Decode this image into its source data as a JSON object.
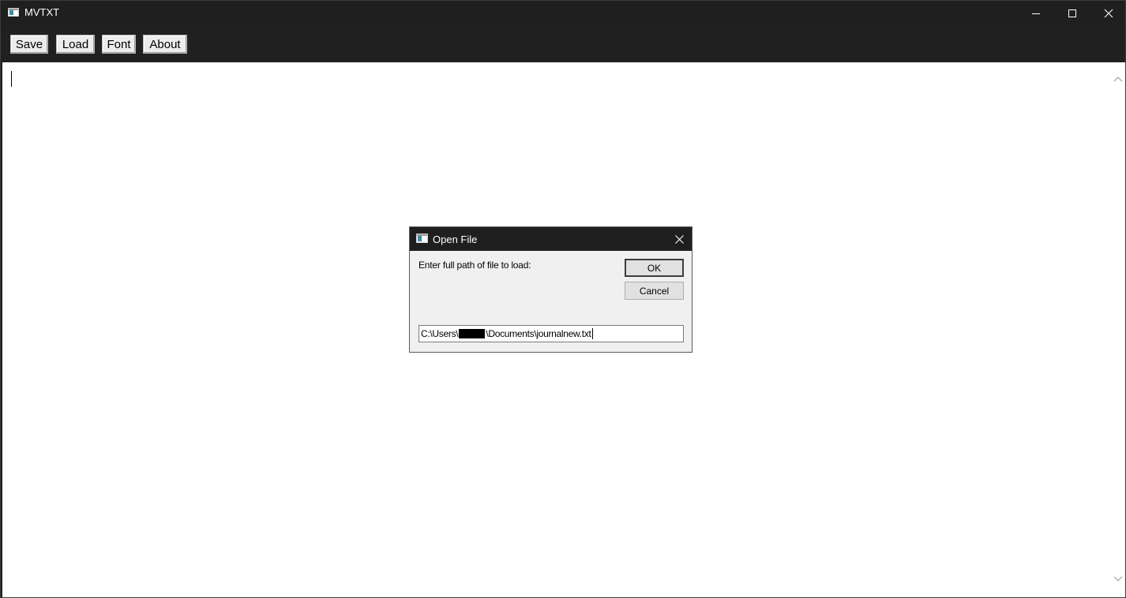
{
  "window": {
    "title": "MVTXT"
  },
  "toolbar": {
    "save_label": "Save",
    "load_label": "Load",
    "font_label": "Font",
    "about_label": "About"
  },
  "editor": {
    "content": ""
  },
  "dialog": {
    "title": "Open File",
    "prompt": "Enter full path of file to load:",
    "ok_label": "OK",
    "cancel_label": "Cancel",
    "path_prefix": "C:\\Users\\",
    "path_suffix": "\\Documents\\journalnew.txt"
  },
  "icons": {
    "app": "app-window-icon",
    "minimize": "minimize-icon",
    "maximize": "maximize-icon",
    "close": "close-icon",
    "scroll_up": "chevron-up-icon",
    "scroll_down": "chevron-down-icon"
  },
  "colors": {
    "titlebar": "#1f1f1f",
    "toolbar": "#202020",
    "dialog_bg": "#f0f0f0",
    "editor_bg": "#ffffff"
  }
}
